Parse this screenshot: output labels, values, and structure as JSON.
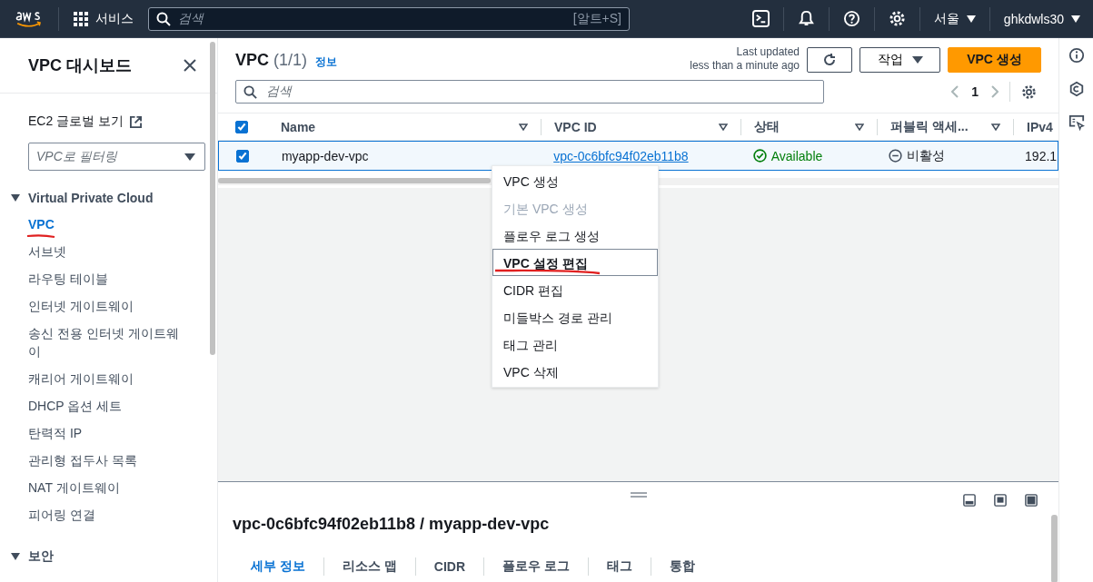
{
  "top_nav": {
    "services_label": "서비스",
    "search_placeholder": "검색",
    "search_shortcut": "[알트+S]",
    "region": "서울",
    "account": "ghkdwls30"
  },
  "sidebar": {
    "title": "VPC 대시보드",
    "ec2_link": "EC2 글로벌 보기",
    "filter_placeholder": "VPC로 필터링",
    "sections": [
      {
        "title": "Virtual Private Cloud",
        "expanded": true,
        "items": [
          {
            "label": "VPC",
            "selected": true,
            "underlined": true
          },
          {
            "label": "서브넷",
            "selected": false,
            "underlined": false
          },
          {
            "label": "라우팅 테이블",
            "selected": false,
            "underlined": false
          },
          {
            "label": "인터넷 게이트웨이",
            "selected": false,
            "underlined": false
          },
          {
            "label": "송신 전용 인터넷 게이트웨이",
            "selected": false,
            "underlined": false
          },
          {
            "label": "캐리어 게이트웨이",
            "selected": false,
            "underlined": false
          },
          {
            "label": "DHCP 옵션 세트",
            "selected": false,
            "underlined": false
          },
          {
            "label": "탄력적 IP",
            "selected": false,
            "underlined": false
          },
          {
            "label": "관리형 접두사 목록",
            "selected": false,
            "underlined": false
          },
          {
            "label": "NAT 게이트웨이",
            "selected": false,
            "underlined": false
          },
          {
            "label": "피어링 연결",
            "selected": false,
            "underlined": false
          }
        ]
      },
      {
        "title": "보안",
        "expanded": true
      }
    ]
  },
  "table_panel": {
    "title": "VPC",
    "count": "(1/1)",
    "info_link": "정보",
    "last_updated_label": "Last updated",
    "last_updated_value": "less than a minute ago",
    "actions_button": "작업",
    "create_button": "VPC 생성",
    "search_placeholder": "검색",
    "page": "1",
    "columns": [
      {
        "label": "Name"
      },
      {
        "label": "VPC ID"
      },
      {
        "label": "상태"
      },
      {
        "label": "퍼블릭 액세..."
      },
      {
        "label": "IPv4"
      }
    ],
    "header_checked": true,
    "rows": [
      {
        "selected": true,
        "checked": true,
        "name": "myapp-dev-vpc",
        "vpc_id": "vpc-0c6bfc94f02eb11b8",
        "status": "Available",
        "public_access": "비활성",
        "ipv4": "192.1"
      }
    ]
  },
  "context_menu": {
    "items": [
      {
        "label": "VPC 생성",
        "disabled": false,
        "highlighted": false,
        "underlined": false
      },
      {
        "label": "기본 VPC 생성",
        "disabled": true,
        "highlighted": false,
        "underlined": false
      },
      {
        "label": "플로우 로그 생성",
        "disabled": false,
        "highlighted": false,
        "underlined": false
      },
      {
        "label": "VPC 설정 편집",
        "disabled": false,
        "highlighted": true,
        "underlined": true
      },
      {
        "label": "CIDR 편집",
        "disabled": false,
        "highlighted": false,
        "underlined": false
      },
      {
        "label": "미들박스 경로 관리",
        "disabled": false,
        "highlighted": false,
        "underlined": false
      },
      {
        "label": "태그 관리",
        "disabled": false,
        "highlighted": false,
        "underlined": false
      },
      {
        "label": "VPC 삭제",
        "disabled": false,
        "highlighted": false,
        "underlined": false
      }
    ]
  },
  "detail_panel": {
    "title": "vpc-0c6bfc94f02eb11b8 / myapp-dev-vpc",
    "tabs": [
      {
        "label": "세부 정보",
        "selected": true
      },
      {
        "label": "리소스 맵",
        "selected": false
      },
      {
        "label": "CIDR",
        "selected": false
      },
      {
        "label": "플로우 로그",
        "selected": false
      },
      {
        "label": "태그",
        "selected": false
      },
      {
        "label": "통합",
        "selected": false
      }
    ]
  }
}
